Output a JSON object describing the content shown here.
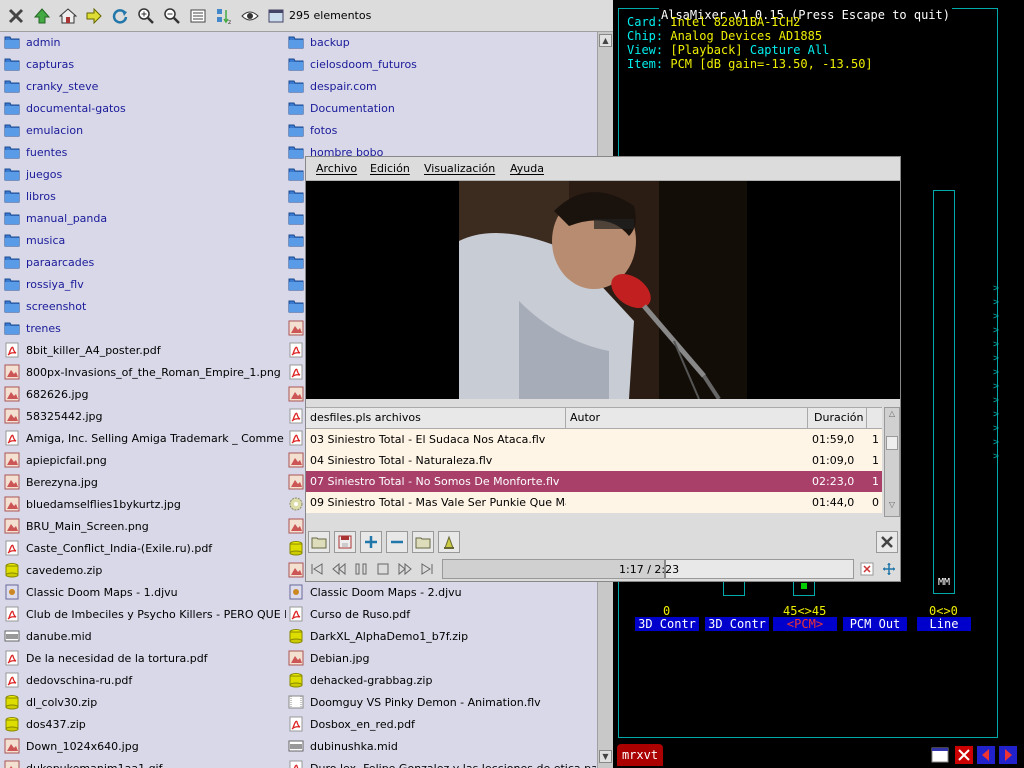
{
  "file_manager": {
    "item_count": "295 elementos",
    "toolbar_icons": [
      "close-icon",
      "up-arrow-icon",
      "home-icon",
      "go-icon",
      "refresh-icon",
      "zoom-in-icon",
      "zoom-out-icon",
      "list-view-icon",
      "sort-icon",
      "eye-icon",
      "window-icon"
    ],
    "left_column": [
      {
        "name": "admin",
        "type": "dir"
      },
      {
        "name": "capturas",
        "type": "dir"
      },
      {
        "name": "cranky_steve",
        "type": "dir"
      },
      {
        "name": "documental-gatos",
        "type": "dir"
      },
      {
        "name": "emulacion",
        "type": "dir"
      },
      {
        "name": "fuentes",
        "type": "dir"
      },
      {
        "name": "juegos",
        "type": "dir"
      },
      {
        "name": "libros",
        "type": "dir"
      },
      {
        "name": "manual_panda",
        "type": "dir"
      },
      {
        "name": "musica",
        "type": "dir"
      },
      {
        "name": "paraarcades",
        "type": "dir"
      },
      {
        "name": "rossiya_flv",
        "type": "dir"
      },
      {
        "name": "screenshot",
        "type": "dir"
      },
      {
        "name": "trenes",
        "type": "dir"
      },
      {
        "name": "8bit_killer_A4_poster.pdf",
        "type": "pdf"
      },
      {
        "name": "800px-Invasions_of_the_Roman_Empire_1.png",
        "type": "img"
      },
      {
        "name": "682626.jpg",
        "type": "img"
      },
      {
        "name": "58325442.jpg",
        "type": "img"
      },
      {
        "name": "Amiga, Inc. Selling Amiga Trademark _ Comme",
        "type": "pdf"
      },
      {
        "name": "apiepicfail.png",
        "type": "img"
      },
      {
        "name": "Berezyna.jpg",
        "type": "img"
      },
      {
        "name": "bluedamselflies1bykurtz.jpg",
        "type": "img"
      },
      {
        "name": "BRU_Main_Screen.png",
        "type": "img"
      },
      {
        "name": "Caste_Conflict_India-(Exile.ru).pdf",
        "type": "pdf"
      },
      {
        "name": "cavedemo.zip",
        "type": "zip"
      },
      {
        "name": "Classic Doom Maps - 1.djvu",
        "type": "djvu"
      },
      {
        "name": "Club de Imbeciles y Psycho Killers - PERO QUE M",
        "type": "pdf"
      },
      {
        "name": "danube.mid",
        "type": "audio"
      },
      {
        "name": "De la necesidad de la tortura.pdf",
        "type": "pdf"
      },
      {
        "name": "dedovschina-ru.pdf",
        "type": "pdf"
      },
      {
        "name": "dl_colv30.zip",
        "type": "zip"
      },
      {
        "name": "dos437.zip",
        "type": "zip"
      },
      {
        "name": "Down_1024x640.jpg",
        "type": "img"
      },
      {
        "name": "dukepukemanim1aa1.gif",
        "type": "img"
      }
    ],
    "right_column": [
      {
        "name": "backup",
        "type": "dir"
      },
      {
        "name": "cielosdoom_futuros",
        "type": "dir"
      },
      {
        "name": "despair.com",
        "type": "dir"
      },
      {
        "name": "Documentation",
        "type": "dir"
      },
      {
        "name": "fotos",
        "type": "dir"
      },
      {
        "name": "hombre bobo",
        "type": "dir"
      },
      {
        "name": "",
        "type": "dir"
      },
      {
        "name": "",
        "type": "dir"
      },
      {
        "name": "",
        "type": "dir"
      },
      {
        "name": "",
        "type": "dir"
      },
      {
        "name": "",
        "type": "dir"
      },
      {
        "name": "",
        "type": "dir"
      },
      {
        "name": "",
        "type": "dir"
      },
      {
        "name": "",
        "type": "img"
      },
      {
        "name": "",
        "type": "pdf"
      },
      {
        "name": "",
        "type": "pdf"
      },
      {
        "name": "",
        "type": "img"
      },
      {
        "name": "",
        "type": "pdf"
      },
      {
        "name": "",
        "type": "pdf"
      },
      {
        "name": "",
        "type": "img"
      },
      {
        "name": "",
        "type": "img"
      },
      {
        "name": "",
        "type": "gear"
      },
      {
        "name": "",
        "type": "img"
      },
      {
        "name": "",
        "type": "zip"
      },
      {
        "name": "",
        "type": "img"
      },
      {
        "name": "Classic Doom Maps - 2.djvu",
        "type": "djvu"
      },
      {
        "name": "Curso de Ruso.pdf",
        "type": "pdf"
      },
      {
        "name": "DarkXL_AlphaDemo1_b7f.zip",
        "type": "zip"
      },
      {
        "name": "Debian.jpg",
        "type": "img"
      },
      {
        "name": "dehacked-grabbag.zip",
        "type": "zip"
      },
      {
        "name": "Doomguy VS Pinky Demon - Animation.flv",
        "type": "video"
      },
      {
        "name": "Dosbox_en_red.pdf",
        "type": "pdf"
      },
      {
        "name": "dubinushka.mid",
        "type": "audio"
      },
      {
        "name": "Duro lex, Felipe Gonzalez y las lecciones de etica pa",
        "type": "pdf"
      }
    ]
  },
  "alsamixer": {
    "title": "AlsaMixer v1.0.15 (Press Escape to quit)",
    "card_label": "Card:",
    "card_value": "Intel 82801BA-ICH2",
    "chip_label": "Chip:",
    "chip_value": "Analog Devices AD1885",
    "view_label": "View:",
    "view_playback": "[Playback]",
    "view_capture": "Capture",
    "view_all": "All",
    "item_label": "Item:",
    "item_value": "PCM [dB gain=-13.50, -13.50]",
    "mm_label": "MM",
    "channel_values": [
      "0",
      "45<>45",
      "0<>0"
    ],
    "channels": [
      "3D Contr",
      "3D Contr",
      "PCM",
      "PCM Out",
      "Line"
    ],
    "selected_channel": "PCM"
  },
  "terminal_tab": {
    "label": "mrxvt"
  },
  "player": {
    "menus": [
      "Archivo",
      "Edición",
      "Visualización",
      "Ayuda"
    ],
    "playlist_header": {
      "title": "desfiles.pls archivos",
      "author": "Autor",
      "duration": "Duración"
    },
    "playlist": [
      {
        "title": "03 Siniestro Total - El Sudaca Nos Ataca.flv",
        "duration": "01:59,0",
        "extra": "1",
        "selected": false
      },
      {
        "title": "04 Siniestro Total - Naturaleza.flv",
        "duration": "01:09,0",
        "extra": "1",
        "selected": false
      },
      {
        "title": "07 Siniestro Total - No Somos De Monforte.flv",
        "duration": "02:23,0",
        "extra": "1",
        "selected": true
      },
      {
        "title": "09 Siniestro Total - Mas Vale Ser Punkie Que Ma",
        "duration": "01:44,0",
        "extra": "0",
        "selected": false
      }
    ],
    "time_display": "1:17 / 2:23",
    "progress": 0.538
  },
  "colors": {
    "fm_bg": "#d8d8e8",
    "dir_text": "#1a1a9a",
    "selected_row": "#a8406a",
    "playlist_bg": "#fff5e6",
    "term_cyan": "#00eeee",
    "term_yellow": "#eeee00"
  }
}
